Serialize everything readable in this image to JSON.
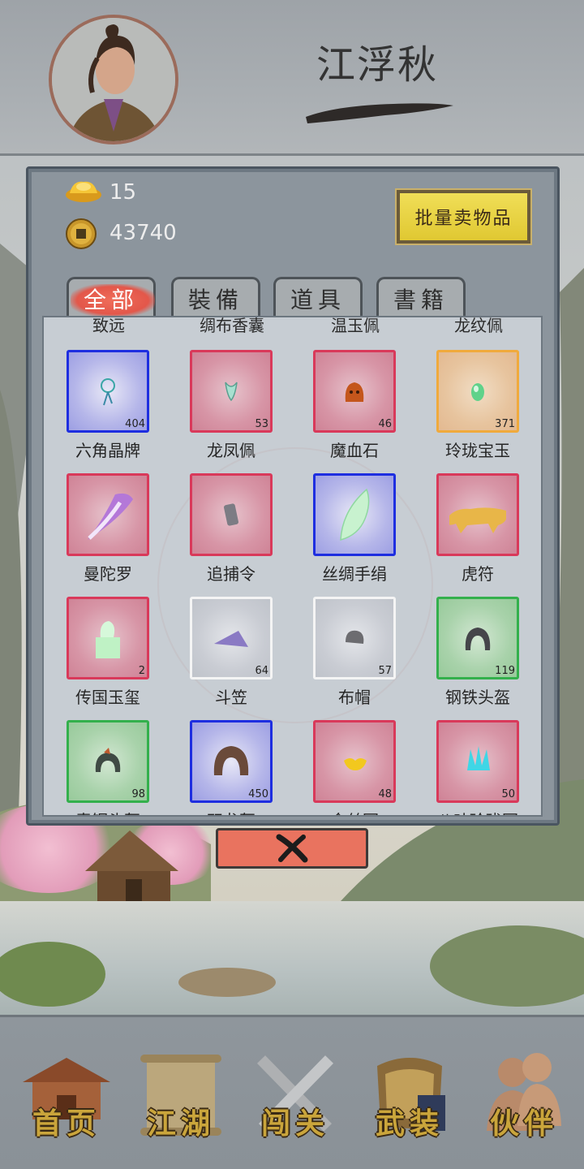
{
  "player": {
    "name": "江浮秋"
  },
  "currency": {
    "ingot": "15",
    "coins": "43740"
  },
  "actions": {
    "sell_all": "批量卖物品"
  },
  "tabs": [
    {
      "label": "全部",
      "active": true
    },
    {
      "label": "裝備",
      "active": false
    },
    {
      "label": "道具",
      "active": false
    },
    {
      "label": "書籍",
      "active": false
    }
  ],
  "partial_top_row": [
    "致远",
    "绸布香囊",
    "温玉佩",
    "龙纹佩"
  ],
  "items": [
    {
      "name": "六角晶牌",
      "qty": "404",
      "rarity": "blue",
      "icon": "charm-icon"
    },
    {
      "name": "龙凤佩",
      "qty": "53",
      "rarity": "red",
      "icon": "pendant-icon"
    },
    {
      "name": "魔血石",
      "qty": "46",
      "rarity": "red",
      "icon": "stone-icon"
    },
    {
      "name": "玲珑宝玉",
      "qty": "371",
      "rarity": "gold",
      "icon": "jade-icon"
    },
    {
      "name": "曼陀罗",
      "qty": "",
      "rarity": "red",
      "icon": "flower-icon"
    },
    {
      "name": "追捕令",
      "qty": "",
      "rarity": "red",
      "icon": "token-icon"
    },
    {
      "name": "丝绸手绢",
      "qty": "",
      "rarity": "blue",
      "icon": "handkerchief-icon"
    },
    {
      "name": "虎符",
      "qty": "",
      "rarity": "red",
      "icon": "tiger-tally-icon"
    },
    {
      "name": "传国玉玺",
      "qty": "2",
      "rarity": "red",
      "icon": "seal-icon"
    },
    {
      "name": "斗笠",
      "qty": "64",
      "rarity": "white",
      "icon": "straw-hat-icon"
    },
    {
      "name": "布帽",
      "qty": "57",
      "rarity": "white",
      "icon": "cloth-cap-icon"
    },
    {
      "name": "钢铁头盔",
      "qty": "119",
      "rarity": "green",
      "icon": "helmet-icon"
    },
    {
      "name": "青铜头盔",
      "qty": "98",
      "rarity": "green",
      "icon": "bronze-helmet-icon"
    },
    {
      "name": "双龙盔",
      "qty": "450",
      "rarity": "blue",
      "icon": "dragon-helmet-icon"
    },
    {
      "name": "金丝冠",
      "qty": "48",
      "rarity": "red",
      "icon": "gold-crown-icon"
    },
    {
      "name": "八叶玲珑冠",
      "qty": "50",
      "rarity": "red",
      "icon": "leaf-crown-icon"
    }
  ],
  "nav": [
    {
      "label": "首页",
      "icon": "home-icon"
    },
    {
      "label": "江湖",
      "icon": "scroll-map-icon"
    },
    {
      "label": "闯关",
      "icon": "crossed-swords-icon"
    },
    {
      "label": "武装",
      "icon": "armor-icon"
    },
    {
      "label": "伙伴",
      "icon": "partners-icon"
    }
  ],
  "colors": {
    "rarity_red": "#d9395a",
    "rarity_blue": "#1e2ee0",
    "rarity_gold": "#f0aa3c",
    "rarity_green": "#33b04c",
    "rarity_white": "#f4f4f4",
    "accent_button": "#e9735f",
    "sell_button": "#e6d03e"
  }
}
